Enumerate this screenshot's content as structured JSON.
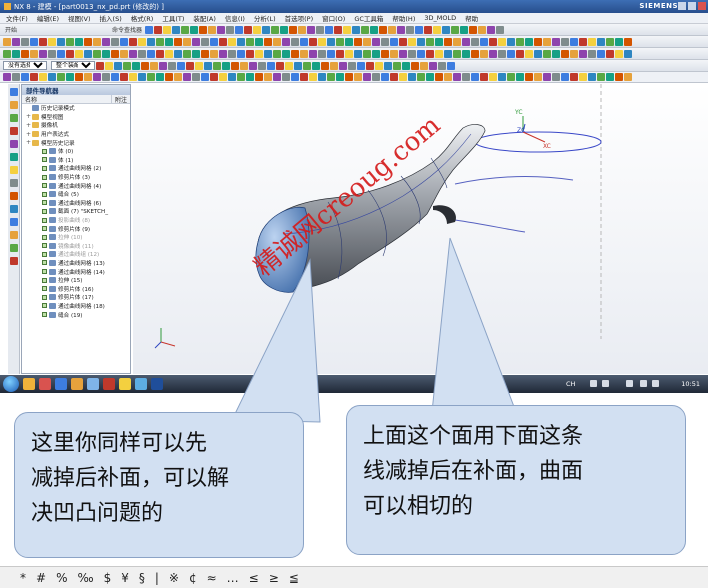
{
  "window": {
    "title": "NX 8 - 建模 - [part0013_nx_pd.prt  (修改的) ]",
    "brand": "SIEMENS"
  },
  "menu": [
    "文件(F)",
    "编辑(E)",
    "视图(V)",
    "插入(S)",
    "格式(R)",
    "工具(T)",
    "装配(A)",
    "信息(I)",
    "分析(L)",
    "首选项(P)",
    "窗口(O)",
    "GC工具箱",
    "帮助(H)",
    "3D_MOLD",
    "帮助"
  ],
  "toolbar": {
    "start_label": "开始",
    "command_finder": "命令查找器",
    "selection_filter": "没有选择过滤器",
    "assembly_scope": "整个装配"
  },
  "navigator": {
    "title": "部件导航器",
    "columns": [
      "名称",
      "附注"
    ],
    "rows": [
      {
        "label": "历史记录模式",
        "kind": "mode"
      },
      {
        "label": "模型视图",
        "kind": "folder"
      },
      {
        "label": "摄像机",
        "kind": "folder"
      },
      {
        "label": "用户表达式",
        "kind": "folder"
      },
      {
        "label": "模型历史记录",
        "kind": "folder"
      },
      {
        "label": "体 (0)",
        "kind": "feature"
      },
      {
        "label": "体 (1)",
        "kind": "feature"
      },
      {
        "label": "通过曲线网格 (2)",
        "kind": "feature"
      },
      {
        "label": "修剪片体 (3)",
        "kind": "feature"
      },
      {
        "label": "通过曲线网格 (4)",
        "kind": "feature"
      },
      {
        "label": "缝合 (5)",
        "kind": "feature"
      },
      {
        "label": "通过曲线网格 (6)",
        "kind": "feature"
      },
      {
        "label": "截面 (7) \"SKETCH_",
        "kind": "feature"
      },
      {
        "label": "投影曲线 (8)",
        "kind": "dim"
      },
      {
        "label": "修剪片体 (9)",
        "kind": "feature"
      },
      {
        "label": "拉伸 (10)",
        "kind": "dim"
      },
      {
        "label": "镜像曲线 (11)",
        "kind": "dim"
      },
      {
        "label": "通过曲线组 (12)",
        "kind": "dim"
      },
      {
        "label": "通过曲线网格 (13)",
        "kind": "feature"
      },
      {
        "label": "通过曲线网格 (14)",
        "kind": "feature"
      },
      {
        "label": "拉伸 (15)",
        "kind": "feature"
      },
      {
        "label": "修剪片体 (16)",
        "kind": "feature"
      },
      {
        "label": "修剪片体 (17)",
        "kind": "feature"
      },
      {
        "label": "通过曲线网格 (18)",
        "kind": "feature"
      },
      {
        "label": "缝合 (19)",
        "kind": "feature"
      }
    ]
  },
  "viewport": {
    "axis_labels": {
      "x": "XC",
      "y": "YC",
      "z": "ZC"
    }
  },
  "taskbar": {
    "clock": "10:51",
    "lang": "CH"
  },
  "callouts": {
    "left": [
      "这里你同样可以先",
      "减掉后补面，可以解",
      "决凹凸问题的"
    ],
    "right": [
      "上面这个面用下面这条",
      "线减掉后在补面，曲面",
      "可以相切的"
    ]
  },
  "watermark": "精诚网creoug.com",
  "symbols": [
    "*",
    "#",
    "%",
    "‰",
    "$",
    "¥",
    "§",
    "|",
    "※",
    "¢",
    "≈",
    "…",
    "≤",
    "≥",
    "≦"
  ],
  "colors": {
    "callout_fill": "#d2e0f2",
    "watermark": "#d51c1c",
    "nx_blue": "#274e8c"
  }
}
